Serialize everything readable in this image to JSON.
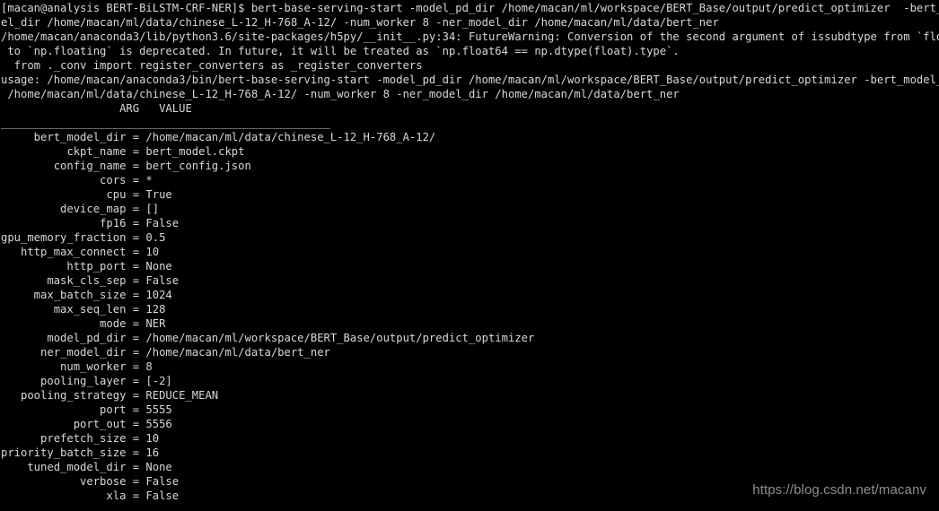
{
  "terminal": {
    "background_color": "#000000",
    "text_color": "#d8d8d8",
    "prompt_user": "macan",
    "prompt_host": "analysis",
    "prompt_dir": "BERT-BiLSTM-CRF-NER",
    "prompt_symbol": "$",
    "command": "bert-base-serving-start -model_pd_dir /home/macan/ml/workspace/BERT_Base/output/predict_optimizer  -bert_model_dir /home/macan/ml/data/chinese_L-12_H-768_A-12/ -num_worker 8 -ner_model_dir /home/macan/ml/data/bert_ner",
    "lines": [
      "[macan@analysis BERT-BiLSTM-CRF-NER]$ bert-base-serving-start -model_pd_dir /home/macan/ml/workspace/BERT_Base/output/predict_optimizer  -bert_model",
      "_dir /home/macan/ml/data/chinese_L-12_H-768_A-12/ -num_worker 8 -ner_model_dir /home/macan/ml/data/bert_ner",
      "/home/macan/anaconda3/lib/python3.6/site-packages/h5py/__init__.py:34: FutureWarning: Conversion of the second argument of issubdtype from `float` t",
      "o `np.floating` is deprecated. In future, it will be treated as `np.float64 == np.dtype(float).type`.",
      "  from ._conv import register_converters as _register_converters",
      "usage: /home/macan/anaconda3/bin/bert-base-serving-start -model_pd_dir /home/macan/ml/workspace/BERT_Base/output/predict_optimizer -bert_model_dir /",
      "home/macan/ml/data/chinese_L-12_H-768_A-12/ -num_worker 8 -ner_model_dir /home/macan/ml/data/bert_ner",
      "                 ARG   VALUE",
      "__________________________________________________",
      "     bert_model_dir = /home/macan/ml/data/chinese_L-12_H-768_A-12/",
      "         ckpt_name = bert_model.ckpt",
      "        config_name = bert_config.json",
      "               cors = *",
      "                cpu = True",
      "         device_map = []",
      "               fp16 = False",
      "gpu_memory_fraction = 0.5",
      "   http_max_connect = 10",
      "          http_port = None",
      "       mask_cls_sep = False",
      "     max_batch_size = 1024",
      "        max_seq_len = 128",
      "               mode = NER",
      "       model_pd_dir = /home/macan/ml/workspace/BERT_Base/output/predict_optimizer",
      "      ner_model_dir = /home/macan/ml/data/bert_ner",
      "         num_worker = 8",
      "      pooling_layer = [-2]",
      "   pooling_strategy = REDUCE_MEAN",
      "               port = 5555",
      "           port_out = 5556",
      "     prefetch_size = 10",
      " priority_batch_size = 16",
      "    tuned_model_dir = None",
      "            verbose = False",
      "                xla = False"
    ],
    "warning": {
      "source_path": "/home/macan/anaconda3/lib/python3.6/site-packages/h5py/__init__.py",
      "line_number": "34",
      "type": "FutureWarning",
      "message": "Conversion of the second argument of issubdtype from `float` to `np.floating` is deprecated. In future, it will be treated as `np.float64 == np.dtype(float).type`.",
      "traceback_line": "  from ._conv import register_converters as _register_converters"
    },
    "usage_line": "usage: /home/macan/anaconda3/bin/bert-base-serving-start -model_pd_dir /home/macan/ml/workspace/BERT_Base/output/predict_optimizer -bert_model_dir /home/macan/ml/data/chinese_L-12_H-768_A-12/ -num_worker 8 -ner_model_dir /home/macan/ml/data/bert_ner",
    "table": {
      "header_arg": "ARG",
      "header_value": "VALUE",
      "separator": "__________________________________________________",
      "rows": [
        {
          "arg": "bert_model_dir",
          "value": "/home/macan/ml/data/chinese_L-12_H-768_A-12/"
        },
        {
          "arg": "ckpt_name",
          "value": "bert_model.ckpt"
        },
        {
          "arg": "config_name",
          "value": "bert_config.json"
        },
        {
          "arg": "cors",
          "value": "*"
        },
        {
          "arg": "cpu",
          "value": "True"
        },
        {
          "arg": "device_map",
          "value": "[]"
        },
        {
          "arg": "fp16",
          "value": "False"
        },
        {
          "arg": "gpu_memory_fraction",
          "value": "0.5"
        },
        {
          "arg": "http_max_connect",
          "value": "10"
        },
        {
          "arg": "http_port",
          "value": "None"
        },
        {
          "arg": "mask_cls_sep",
          "value": "False"
        },
        {
          "arg": "max_batch_size",
          "value": "1024"
        },
        {
          "arg": "max_seq_len",
          "value": "128"
        },
        {
          "arg": "mode",
          "value": "NER"
        },
        {
          "arg": "model_pd_dir",
          "value": "/home/macan/ml/workspace/BERT_Base/output/predict_optimizer"
        },
        {
          "arg": "ner_model_dir",
          "value": "/home/macan/ml/data/bert_ner"
        },
        {
          "arg": "num_worker",
          "value": "8"
        },
        {
          "arg": "pooling_layer",
          "value": "[-2]"
        },
        {
          "arg": "pooling_strategy",
          "value": "REDUCE_MEAN"
        },
        {
          "arg": "port",
          "value": "5555"
        },
        {
          "arg": "port_out",
          "value": "5556"
        },
        {
          "arg": "prefetch_size",
          "value": "10"
        },
        {
          "arg": "priority_batch_size",
          "value": "16"
        },
        {
          "arg": "tuned_model_dir",
          "value": "None"
        },
        {
          "arg": "verbose",
          "value": "False"
        },
        {
          "arg": "xla",
          "value": "False"
        }
      ]
    }
  },
  "watermark": {
    "text": "https://blog.csdn.net/macanv",
    "color": "#8e8e8e"
  }
}
